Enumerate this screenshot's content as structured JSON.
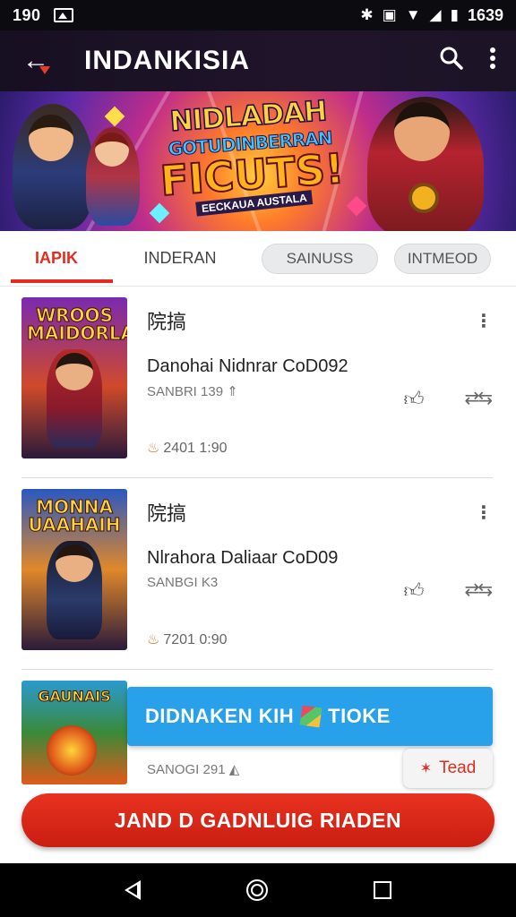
{
  "status_bar": {
    "time": "190",
    "clock": "1639",
    "icons": [
      "bluetooth-icon",
      "nfc-icon",
      "wifi-icon",
      "signal-icon",
      "battery-icon"
    ]
  },
  "app_bar": {
    "title": "INDANKISIA",
    "icons": [
      "back-arrow-icon",
      "search-icon",
      "more-vert-icon"
    ]
  },
  "banner": {
    "line1": "NIDLADAH",
    "line2": "GOTUDINBERRAN",
    "line3": "FICUTS!",
    "line4": "EECKAUA AUSTALA"
  },
  "tabs": [
    {
      "label": "IAPIK",
      "active": true
    },
    {
      "label": "INDERAN",
      "active": false
    },
    {
      "label": "SAINUSS",
      "active": false
    },
    {
      "label": "INTMEOD",
      "active": false
    }
  ],
  "cards": [
    {
      "thumb_title": "WROOS MAIDORLAR",
      "title": "院搞",
      "subtitle": "Danohai Nidnrar CoD092",
      "meta": "SANBRI 139",
      "time": "2401 1:90"
    },
    {
      "thumb_title": "MONNA UAAHAIH",
      "title": "院搞",
      "subtitle": "Nlrahora Daliaar CoD09",
      "meta": "SANBGI K3",
      "time": "7201 0:90"
    },
    {
      "thumb_title": "GAUNAIS",
      "title": "",
      "subtitle": "",
      "meta": "SANOGI 291",
      "time": ""
    }
  ],
  "toast": {
    "text_before": "DIDNAKEN KIH",
    "text_after": "TIOKE"
  },
  "tead_chip": {
    "label": "Tead"
  },
  "cta": {
    "label": "JAND D GADNLUIG RIADEN"
  },
  "colors": {
    "accent": "#e32b1f",
    "toast": "#29a0ea",
    "app_bar": "#1a1224"
  }
}
